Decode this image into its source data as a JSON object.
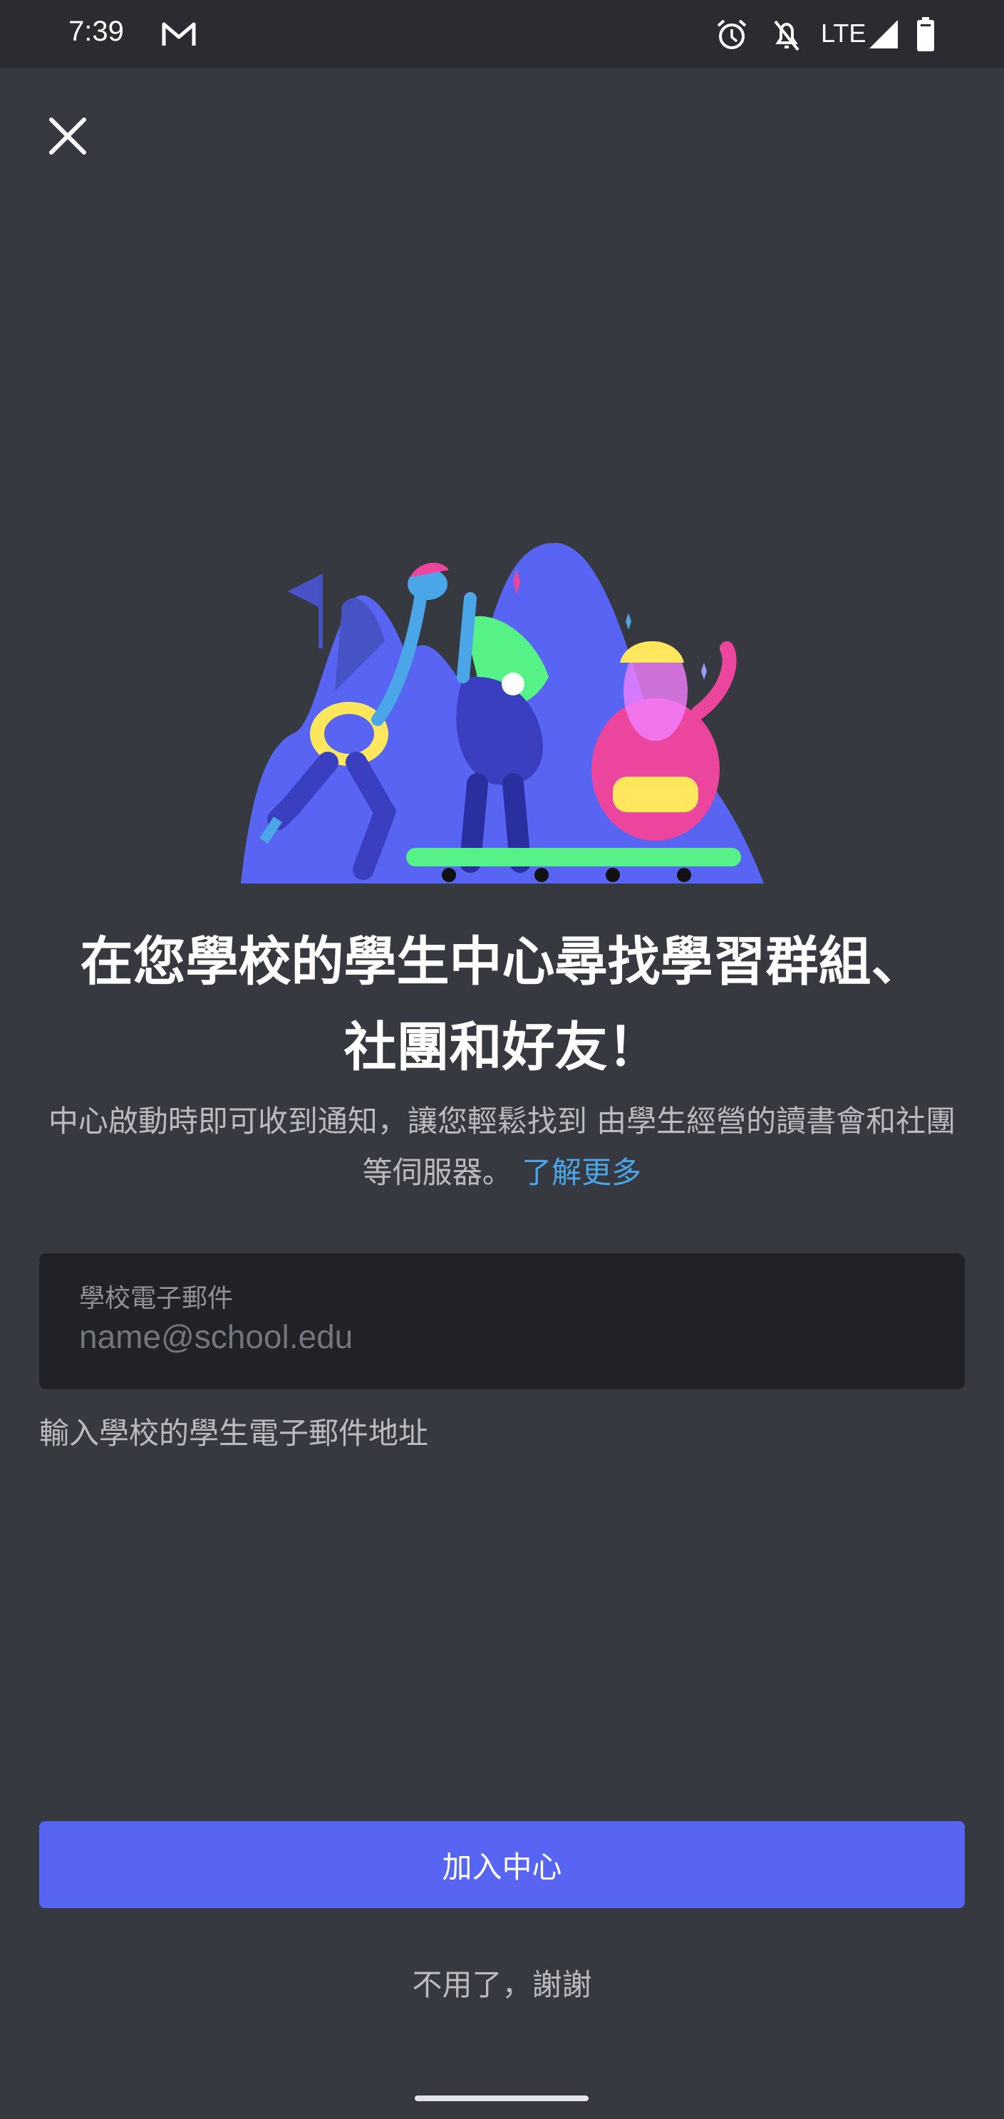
{
  "status_bar": {
    "time": "7:39",
    "left_icons": [
      "gmail-icon"
    ],
    "right_icons": [
      "alarm-icon",
      "notifications-off-icon",
      "signal-icon",
      "battery-icon"
    ],
    "network": "LTE"
  },
  "header": {
    "close_icon": "close-icon"
  },
  "main": {
    "title": "在您學校的學生中心尋找學習群組、社團和好友！",
    "subtitle": "中心啟動時即可收到通知，讓您輕鬆找到 由學生經營的讀書會和社團等伺服器。",
    "learn_more": "了解更多",
    "email_field": {
      "label": "學校電子郵件",
      "placeholder": "name@school.edu",
      "value": ""
    },
    "helper_text": "輸入學校的學生電子郵件地址",
    "join_button": "加入中心",
    "decline_button": "不用了，謝謝"
  },
  "colors": {
    "background": "#36393f",
    "status_bar": "#2a2c31",
    "input_bg": "#202225",
    "primary": "#5865f2",
    "link": "#4ba6e8",
    "muted_text": "#b9bbbe"
  }
}
